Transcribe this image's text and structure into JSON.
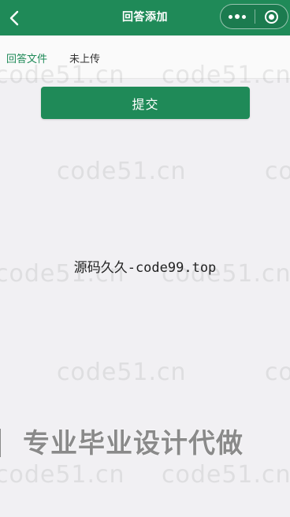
{
  "nav": {
    "title": "回答添加"
  },
  "capsule": {
    "more_icon": "more-dots-icon",
    "close_icon": "target-close-icon"
  },
  "form": {
    "file_label": "回答文件",
    "file_status": "未上传"
  },
  "actions": {
    "submit_label": "提交"
  },
  "watermark": {
    "site": "code51.cn",
    "center_text": "源码久久-code99.top",
    "banner_text": "专业毕业设计代做"
  },
  "colors": {
    "primary": "#1f8a58",
    "background": "#f1f0f3"
  }
}
